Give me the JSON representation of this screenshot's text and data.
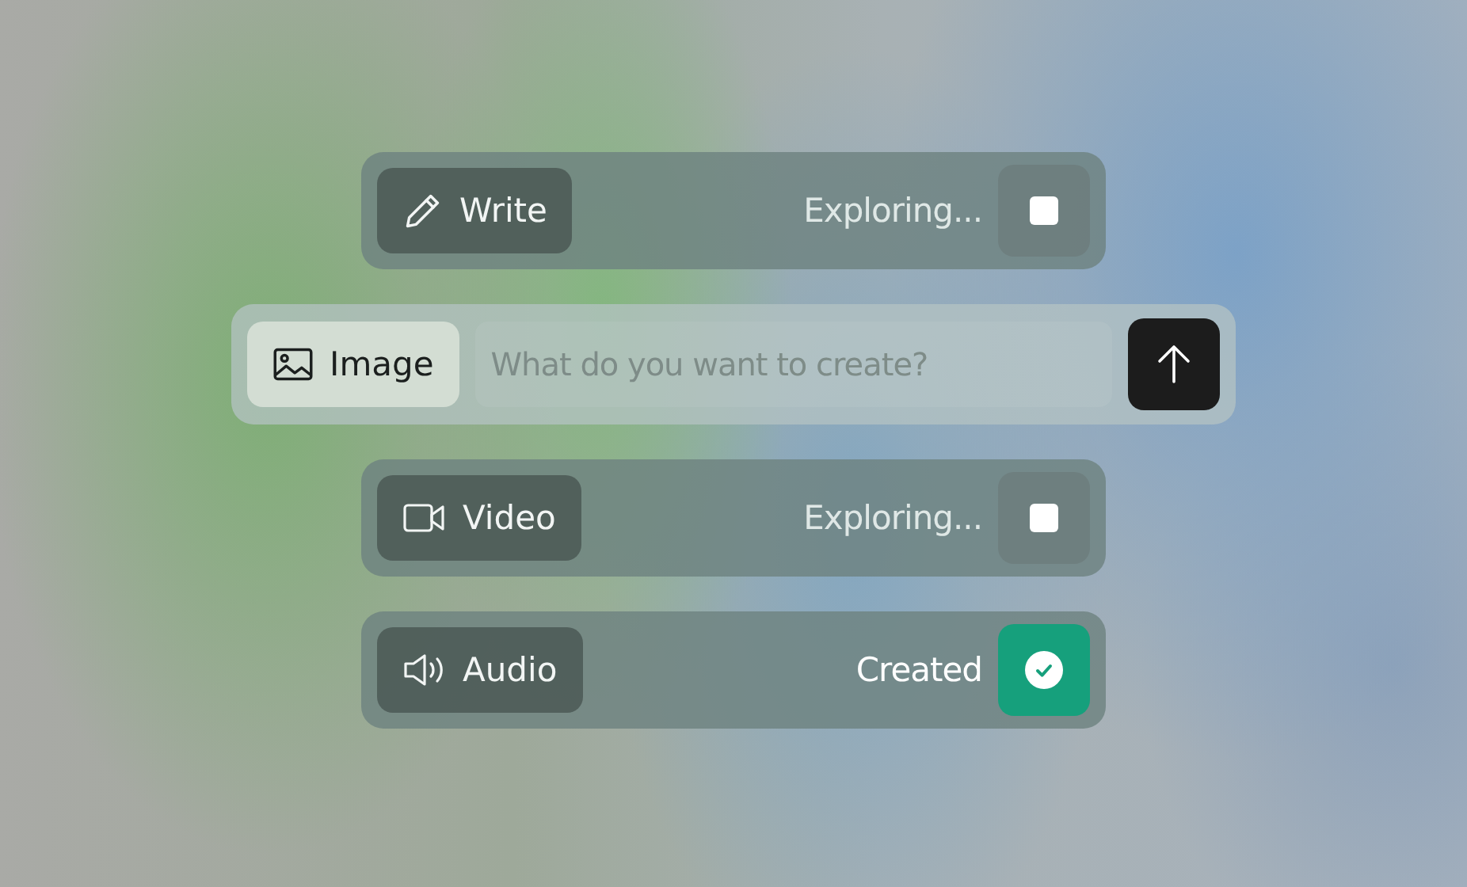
{
  "rows": [
    {
      "kind": "task",
      "mode": "Write",
      "status": "Exploring...",
      "done": false
    },
    {
      "kind": "prompt",
      "mode": "Image",
      "placeholder": "What do you want to create?"
    },
    {
      "kind": "task",
      "mode": "Video",
      "status": "Exploring...",
      "done": false
    },
    {
      "kind": "task",
      "mode": "Audio",
      "status": "Created",
      "done": true
    }
  ]
}
